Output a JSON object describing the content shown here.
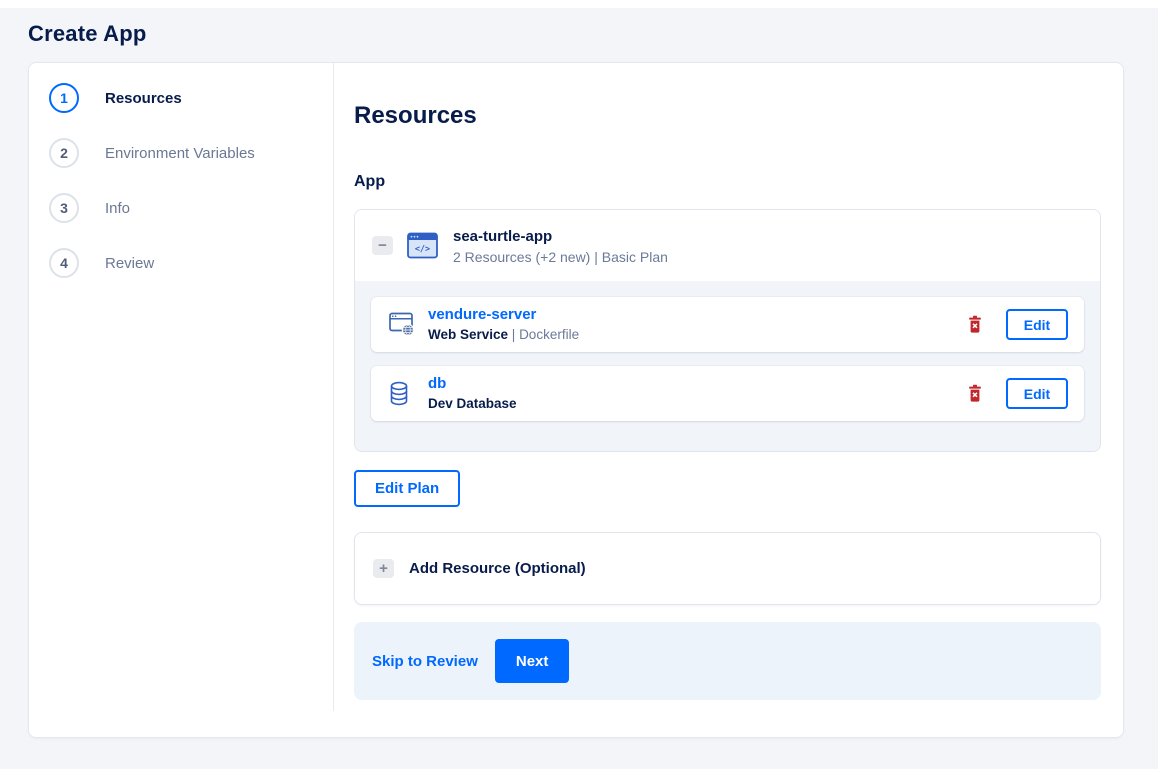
{
  "page": {
    "title": "Create App"
  },
  "colors": {
    "accent_blue": "#0069ff",
    "navy_text": "#081c4b",
    "muted_text": "#6b7a99",
    "page_background": "#f3f5f9",
    "panel_background": "#f1f4f8",
    "footer_background": "#edf3fb",
    "danger_red": "#c0262c",
    "border": "#e0e5ec"
  },
  "icons": {
    "collapse_glyph": "−",
    "add_glyph": "+"
  },
  "steps": [
    {
      "number": "1",
      "label": "Resources",
      "active": true
    },
    {
      "number": "2",
      "label": "Environment Variables",
      "active": false
    },
    {
      "number": "3",
      "label": "Info",
      "active": false
    },
    {
      "number": "4",
      "label": "Review",
      "active": false
    }
  ],
  "content": {
    "heading": "Resources",
    "app_section_label": "App",
    "app": {
      "name": "sea-turtle-app",
      "summary": "2 Resources (+2 new) | Basic Plan",
      "resources": [
        {
          "name": "vendure-server",
          "type": "Web Service",
          "sep": " | ",
          "detail": "Dockerfile",
          "icon": "web-service-icon",
          "edit_label": "Edit"
        },
        {
          "name": "db",
          "type": "Dev Database",
          "icon": "database-icon",
          "edit_label": "Edit"
        }
      ]
    },
    "edit_plan_label": "Edit Plan",
    "add_resource_label": "Add Resource (Optional)"
  },
  "footer": {
    "skip_label": "Skip to Review",
    "next_label": "Next"
  }
}
